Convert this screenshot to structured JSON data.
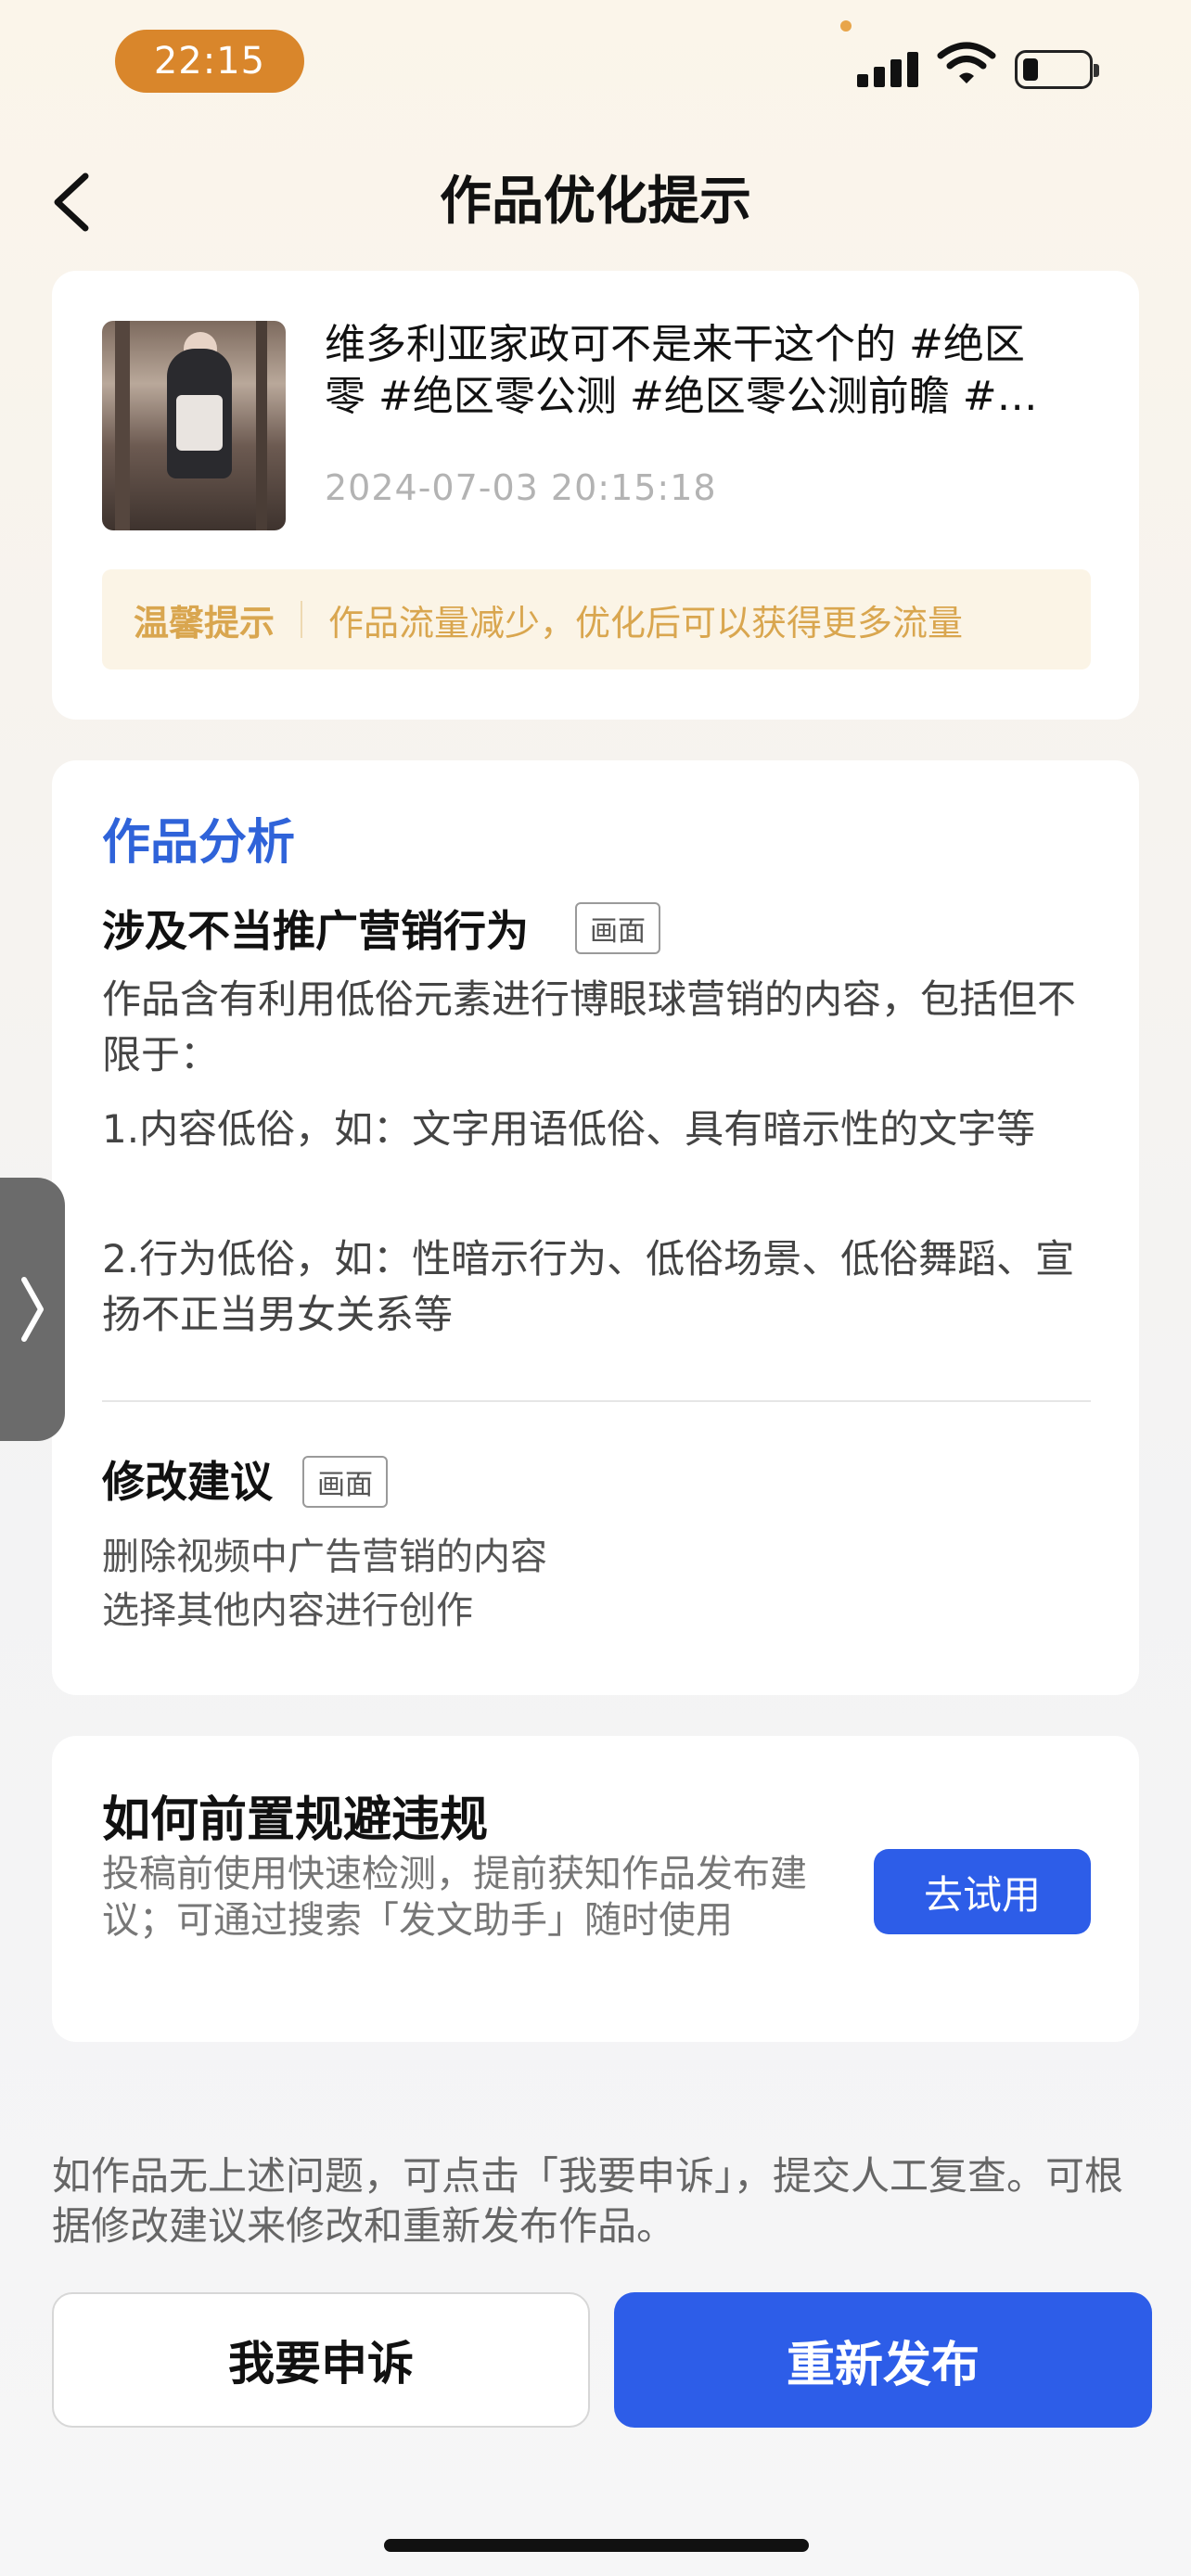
{
  "status_bar": {
    "time": "22:15"
  },
  "nav": {
    "title": "作品优化提示"
  },
  "work": {
    "title": "维多利亚家政可不是来干这个的 #绝区零 #绝区零公测 #绝区零公测前瞻 #绝区零cos",
    "timestamp": "2024-07-03 20:15:18",
    "tip_label": "温馨提示",
    "tip_text": "作品流量减少，优化后可以获得更多流量"
  },
  "analysis": {
    "section_title": "作品分析",
    "issue_title": "涉及不当推广营销行为",
    "issue_tag": "画面",
    "desc1": "作品含有利用低俗元素进行博眼球营销的内容，包括但不限于：",
    "desc2": "1.内容低俗，如：文字用语低俗、具有暗示性的文字等",
    "desc3": "2.行为低俗，如：性暗示行为、低俗场景、低俗舞蹈、宣扬不正当男女关系等",
    "suggest_title": "修改建议",
    "suggest_tag": "画面",
    "suggest_line1": "删除视频中广告营销的内容",
    "suggest_line2": "选择其他内容进行创作"
  },
  "howto": {
    "title": "如何前置规避违规",
    "desc": "投稿前使用快速检测，提前获知作品发布建议；可通过搜索「发文助手」随时使用",
    "button": "去试用"
  },
  "footer": {
    "note": "如作品无上述问题，可点击「我要申诉」，提交人工复查。可根据修改建议来修改和重新发布作品。",
    "appeal_button": "我要申诉",
    "republish_button": "重新发布"
  },
  "colors": {
    "accent": "#2d5de8",
    "title_blue": "#2f63d9",
    "tip_text": "#d9a64f",
    "time_pill": "#d9862b"
  }
}
